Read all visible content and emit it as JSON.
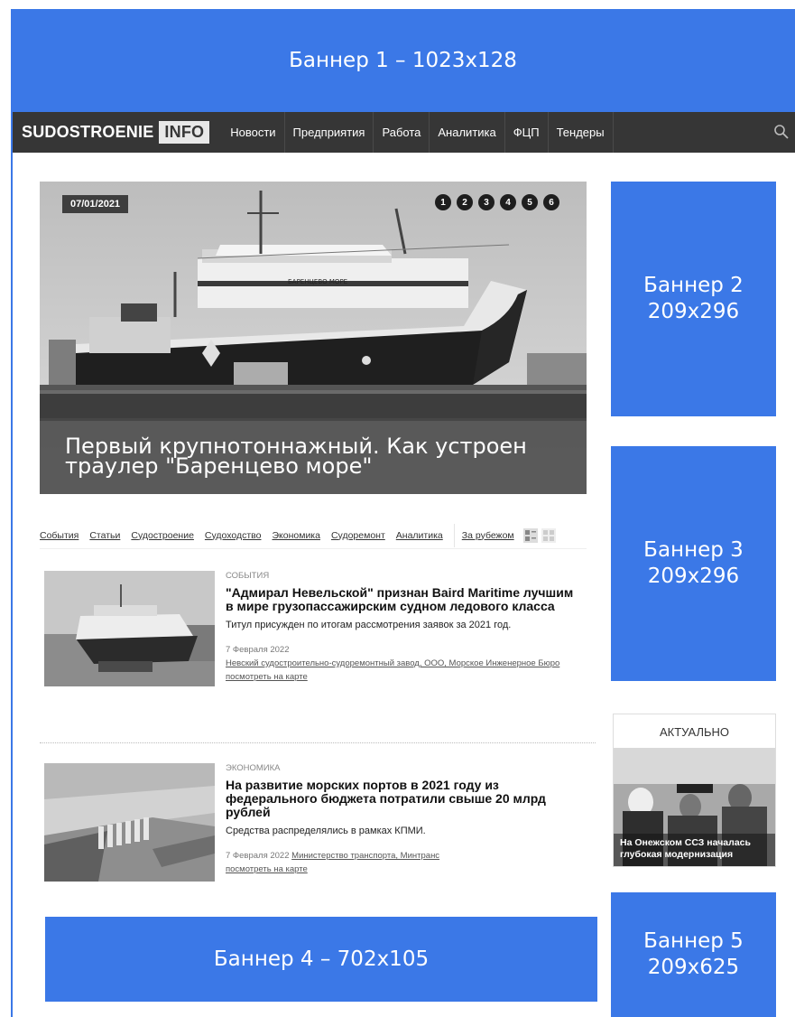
{
  "banners": {
    "b1": "Баннер 1 – 1023x128",
    "b2_line1": "Баннер 2",
    "b2_line2": "209x296",
    "b3_line1": "Баннер 3",
    "b3_line2": "209x296",
    "b4": "Баннер 4 – 702x105",
    "b5_line1": "Баннер 5",
    "b5_line2": "209x625"
  },
  "header": {
    "logo_part1": "SUDOSTROENIE",
    "logo_part2": "INFO",
    "nav": [
      "Новости",
      "Предприятия",
      "Работа",
      "Аналитика",
      "ФЦП",
      "Тендеры"
    ],
    "search_icon": "search-icon"
  },
  "slider": {
    "date": "07/01/2021",
    "dots": [
      "1",
      "2",
      "3",
      "4",
      "5",
      "6"
    ],
    "caption": "Первый крупнотоннажный. Как устроен траулер \"Баренцево море\"",
    "ship_name": "БАРЕНЦЕВО МОРЕ"
  },
  "categories": {
    "tabs": [
      "События",
      "Статьи",
      "Судостроение",
      "Судоходство",
      "Экономика",
      "Судоремонт",
      "Аналитика",
      "За рубежом"
    ],
    "view_icons": [
      "list-view-icon",
      "grid-view-icon"
    ]
  },
  "news": [
    {
      "category": "СОБЫТИЯ",
      "title": "\"Адмирал Невельской\" признан Baird Maritime лучшим в мире грузопассажирским судном ледового класса",
      "lead": "Титул присужден по итогам рассмотрения заявок за 2021 год.",
      "date": "7 Февраля 2022",
      "tags": "Невский судостроительно-судоремонтный завод, ООО, Морское Инженерное Бюро",
      "map_link": "посмотреть на карте"
    },
    {
      "category": "ЭКОНОМИКА",
      "title": "На развитие морских портов в 2021 году из федерального бюджета потратили свыше 20 млрд рублей",
      "lead": "Средства распределялись в рамках КПМИ.",
      "date": "7 Февраля 2022",
      "tags": "Министерство транспорта, Минтранс",
      "map_link": "посмотреть на карте"
    }
  ],
  "aktualno": {
    "title": "АКТУАЛЬНО",
    "caption": "На Онежском ССЗ началась глубокая модернизация"
  },
  "colors": {
    "banner": "#3b78e7",
    "navbar": "#363636"
  }
}
